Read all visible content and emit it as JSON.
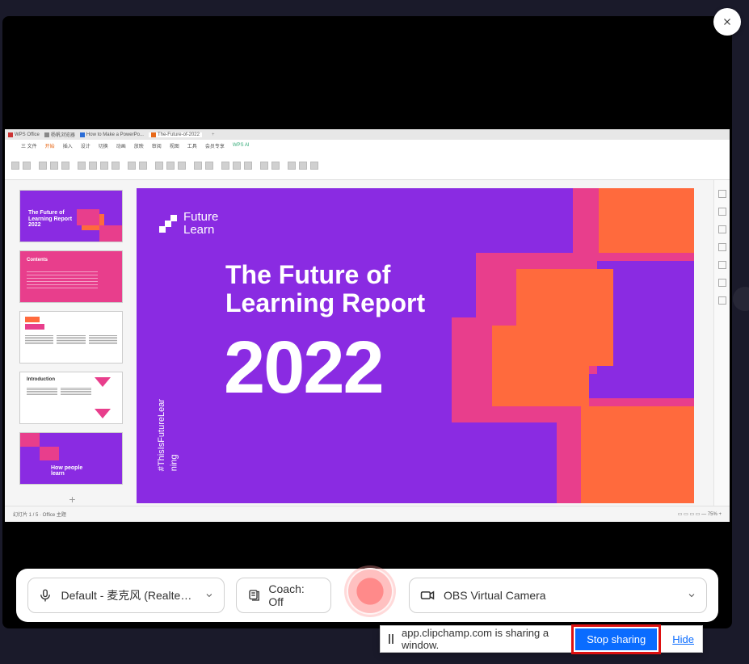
{
  "controls": {
    "mic_label": "Default - 麦克风 (Realtek(R...",
    "coach_label": "Coach: Off",
    "camera_label": "OBS Virtual Camera"
  },
  "sharing": {
    "message": "app.clipchamp.com is sharing a window.",
    "stop_label": "Stop sharing",
    "hide_label": "Hide"
  },
  "shared_app": {
    "tabs": {
      "wps": "WPS Office",
      "t2": "杨帆浏览器",
      "t3": "How to Make a PowerPo...",
      "active": "The-Future-of-2022"
    },
    "menu": {
      "file": "三 文件",
      "start": "开始",
      "m1": "插入",
      "m2": "设计",
      "m3": "切换",
      "m4": "动画",
      "m5": "放映",
      "m6": "审阅",
      "m7": "视图",
      "m8": "工具",
      "m9": "会员专享",
      "m10": "WPS AI"
    },
    "thumbs": {
      "t1_title": "The Future of\nLearning Report\n2022",
      "t2_title": "Contents",
      "t4_title": "Introduction",
      "t5_title": "How people\nlearn"
    },
    "slide": {
      "logo_text": "Future\nLearn",
      "title": "The Future of\nLearning Report",
      "year": "2022",
      "hashtag": "#ThisIsFutureLear\nning"
    }
  }
}
